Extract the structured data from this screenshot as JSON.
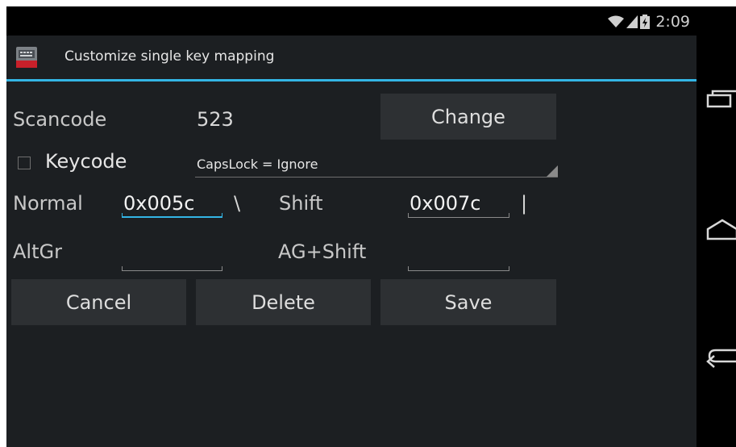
{
  "status_bar": {
    "time": "2:09",
    "icons": [
      "wifi-icon",
      "signal-icon",
      "battery-charging-icon"
    ]
  },
  "dialog": {
    "title": "Customize single key mapping",
    "app_icon": "keyboard-icon",
    "scancode_label": "Scancode",
    "scancode_value": "523",
    "change_button": "Change",
    "keycode_checkbox_checked": false,
    "keycode_label": "Keycode",
    "keycode_spinner_value": "CapsLock = Ignore",
    "normal_label": "Normal",
    "normal_value": "0x005c",
    "normal_char": "\\",
    "shift_label": "Shift",
    "shift_value": "0x007c",
    "shift_char": "|",
    "altgr_label": "AltGr",
    "altgr_value": "",
    "agshift_label": "AG+Shift",
    "agshift_value": "",
    "cancel_button": "Cancel",
    "delete_button": "Delete",
    "save_button": "Save"
  },
  "nav_bar": {
    "icons": [
      "recent-apps-icon",
      "home-icon",
      "back-icon"
    ]
  },
  "colors": {
    "accent": "#33b5e5",
    "dialog_bg": "#1c1f22",
    "button_bg": "#2d3033"
  }
}
